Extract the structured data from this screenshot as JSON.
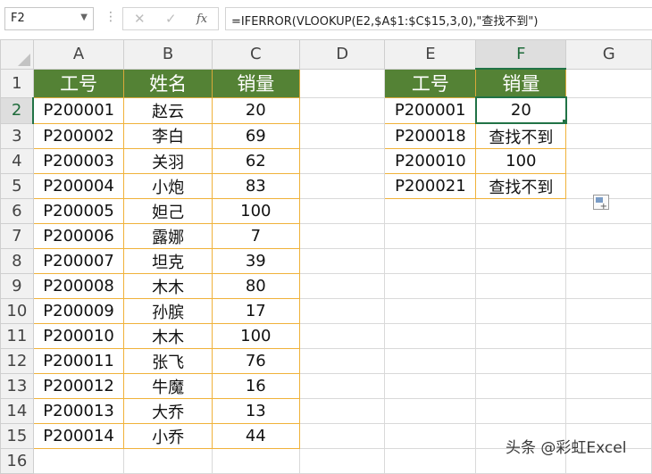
{
  "formula_bar": {
    "name_box": "F2",
    "separator": "⋮",
    "cancel_glyph": "✕",
    "enter_glyph": "✓",
    "fx_label": "fx",
    "formula": "=IFERROR(VLOOKUP(E2,$A$1:$C$15,3,0),\"查找不到\")"
  },
  "columns": [
    "A",
    "B",
    "C",
    "D",
    "E",
    "F",
    "G"
  ],
  "rows": [
    {
      "n": "1",
      "a": "工号",
      "b": "姓名",
      "c": "销量",
      "e": "工号",
      "f": "销量"
    },
    {
      "n": "2",
      "a": "P200001",
      "b": "赵云",
      "c": "20",
      "e": "P200001",
      "f": "20"
    },
    {
      "n": "3",
      "a": "P200002",
      "b": "李白",
      "c": "69",
      "e": "P200018",
      "f": "查找不到"
    },
    {
      "n": "4",
      "a": "P200003",
      "b": "关羽",
      "c": "62",
      "e": "P200010",
      "f": "100"
    },
    {
      "n": "5",
      "a": "P200004",
      "b": "小炮",
      "c": "83",
      "e": "P200021",
      "f": "查找不到"
    },
    {
      "n": "6",
      "a": "P200005",
      "b": "妲己",
      "c": "100",
      "e": "",
      "f": ""
    },
    {
      "n": "7",
      "a": "P200006",
      "b": "露娜",
      "c": "7",
      "e": "",
      "f": ""
    },
    {
      "n": "8",
      "a": "P200007",
      "b": "坦克",
      "c": "39",
      "e": "",
      "f": ""
    },
    {
      "n": "9",
      "a": "P200008",
      "b": "木木",
      "c": "80",
      "e": "",
      "f": ""
    },
    {
      "n": "10",
      "a": "P200009",
      "b": "孙膑",
      "c": "17",
      "e": "",
      "f": ""
    },
    {
      "n": "11",
      "a": "P200010",
      "b": "木木",
      "c": "100",
      "e": "",
      "f": ""
    },
    {
      "n": "12",
      "a": "P200011",
      "b": "张飞",
      "c": "76",
      "e": "",
      "f": ""
    },
    {
      "n": "13",
      "a": "P200012",
      "b": "牛魔",
      "c": "16",
      "e": "",
      "f": ""
    },
    {
      "n": "14",
      "a": "P200013",
      "b": "大乔",
      "c": "13",
      "e": "",
      "f": ""
    },
    {
      "n": "15",
      "a": "P200014",
      "b": "小乔",
      "c": "44",
      "e": "",
      "f": ""
    },
    {
      "n": "16",
      "a": "",
      "b": "",
      "c": "",
      "e": "",
      "f": ""
    }
  ],
  "active_cell": "F2",
  "watermark": "头条 @彩虹Excel",
  "colors": {
    "header_fill": "#548235",
    "table_border": "#f0b23a",
    "selection": "#217346"
  }
}
